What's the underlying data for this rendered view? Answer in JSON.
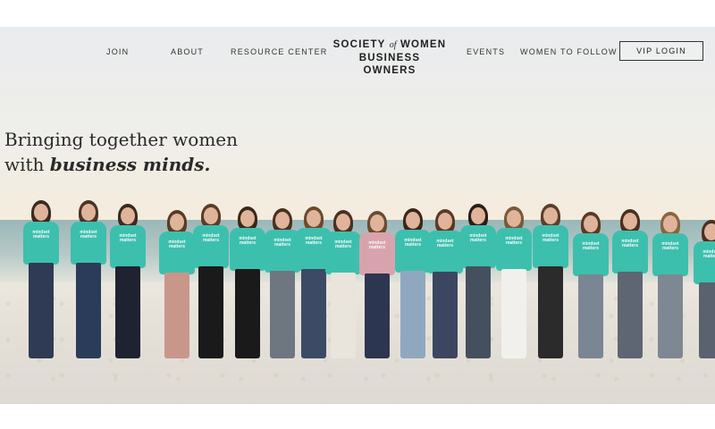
{
  "nav": {
    "items": [
      {
        "label": "JOIN"
      },
      {
        "label": "ABOUT"
      },
      {
        "label": "RESOURCE CENTER"
      },
      {
        "label": "EVENTS"
      },
      {
        "label": "WOMEN TO FOLLOW"
      }
    ],
    "vip_login": "VIP LOGIN"
  },
  "logo": {
    "line1_a": "SOCIETY",
    "line1_of": "of",
    "line1_b": "WOMEN",
    "line2": "BUSINESS OWNERS"
  },
  "hero": {
    "headline_line1": "Bringing together women",
    "headline_line2_plain": "with ",
    "headline_line2_emph": "business minds."
  },
  "shirt_print": "mindset matters",
  "colors": {
    "shirt_teal": "#3dbfae",
    "text_dark": "#2a2a2a"
  }
}
